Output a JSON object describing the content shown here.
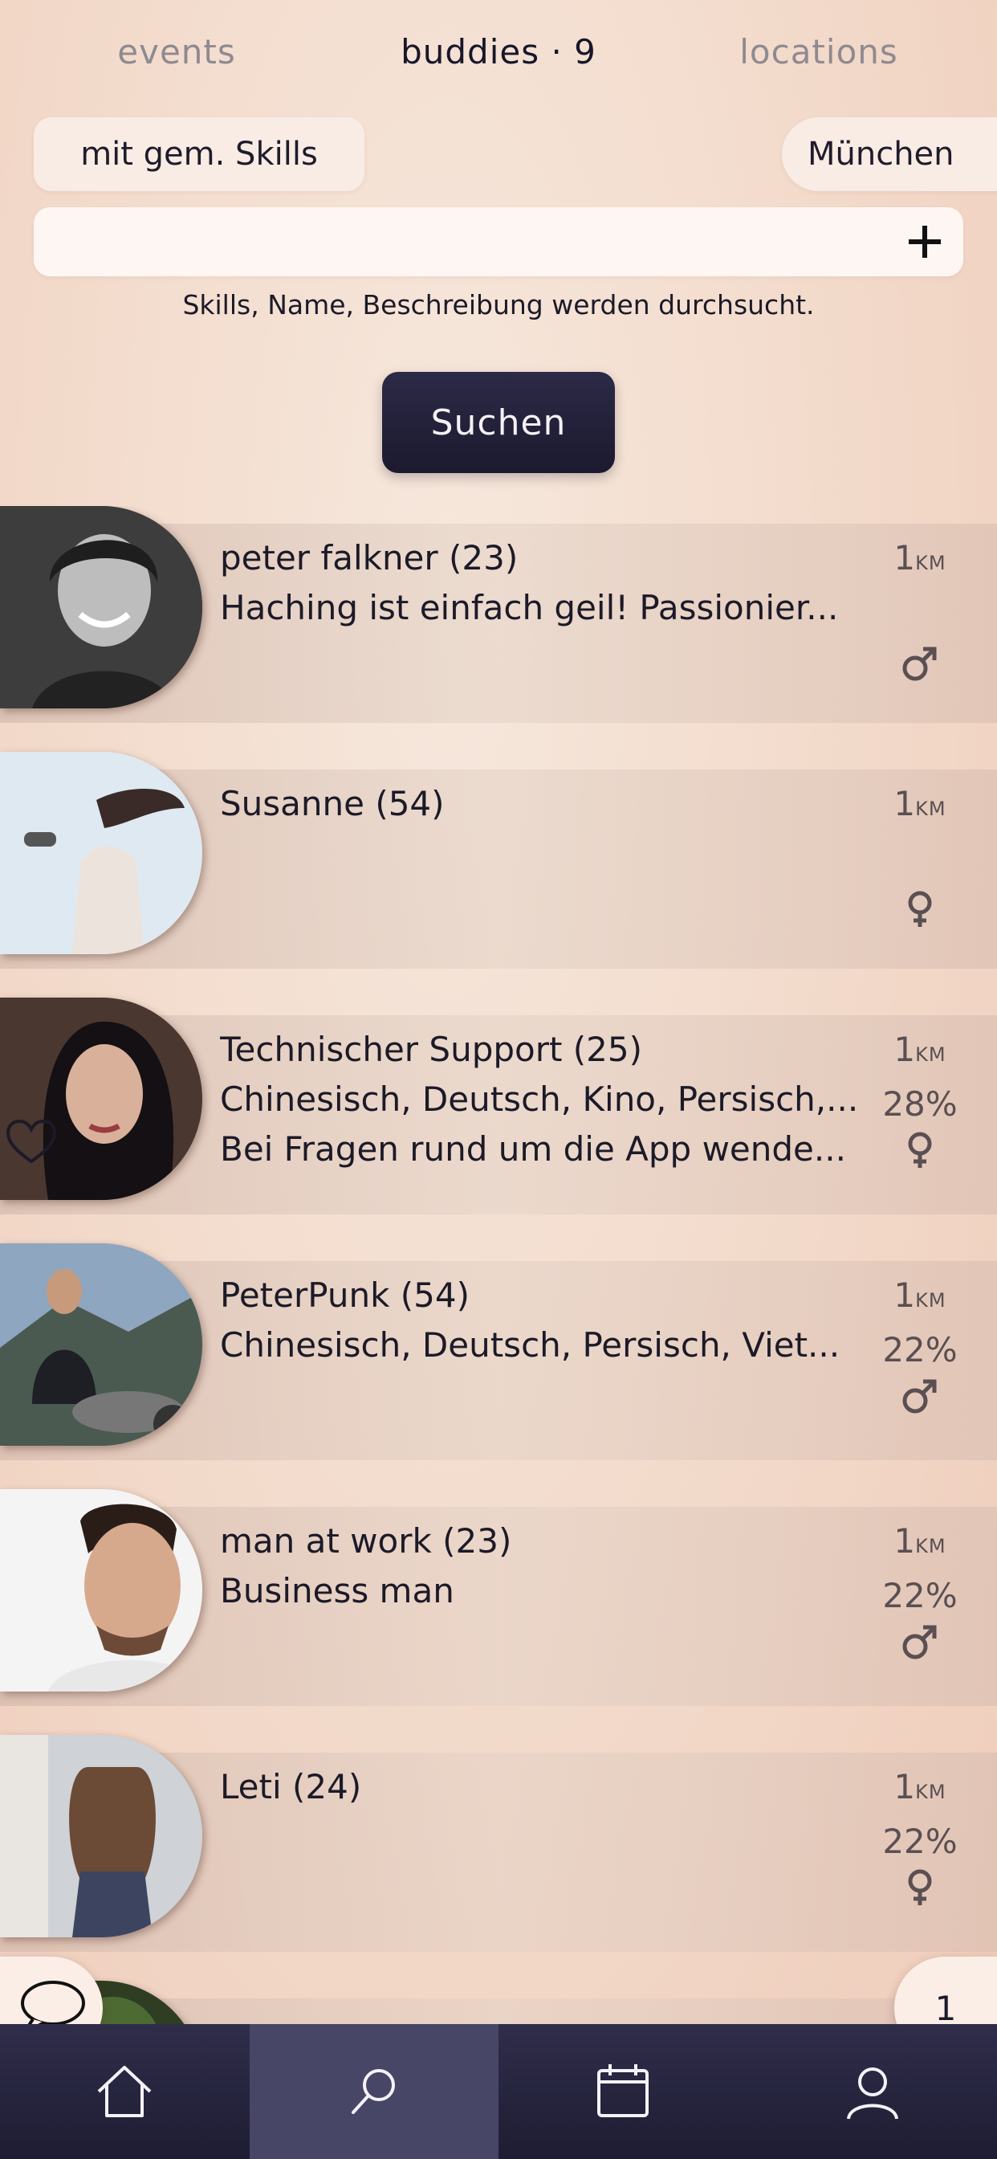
{
  "tabs": [
    {
      "label": "events",
      "active": false
    },
    {
      "label": "buddies · 9",
      "active": true
    },
    {
      "label": "locations",
      "active": false
    }
  ],
  "filters": {
    "skills_chip": "mit gem. Skills",
    "city_chip": "München"
  },
  "search": {
    "value": "",
    "placeholder": "",
    "hint": "Skills, Name, Beschreibung werden durchsucht.",
    "button_label": "Suchen"
  },
  "buddies": [
    {
      "name": "peter falkner (23)",
      "line2": "Haching ist einfach geil! Passionier...",
      "line3": "",
      "distance": "1",
      "unit": "KM",
      "match": "",
      "gender": "male",
      "favorite": false
    },
    {
      "name": "Susanne (54)",
      "line2": "",
      "line3": "",
      "distance": "1",
      "unit": "KM",
      "match": "",
      "gender": "female",
      "favorite": false
    },
    {
      "name": "Technischer Support (25)",
      "line2": "Chinesisch, Deutsch, Kino, Persisch,...",
      "line3": "Bei Fragen rund um die App wende...",
      "distance": "1",
      "unit": "KM",
      "match": "28%",
      "gender": "female",
      "favorite": true
    },
    {
      "name": "PeterPunk (54)",
      "line2": "Chinesisch, Deutsch, Persisch, Viet...",
      "line3": "",
      "distance": "1",
      "unit": "KM",
      "match": "22%",
      "gender": "male",
      "favorite": false
    },
    {
      "name": "man at work (23)",
      "line2": "Business man",
      "line3": "",
      "distance": "1",
      "unit": "KM",
      "match": "22%",
      "gender": "male",
      "favorite": false
    },
    {
      "name": "Leti (24)",
      "line2": "",
      "line3": "",
      "distance": "1",
      "unit": "KM",
      "match": "22%",
      "gender": "female",
      "favorite": false
    }
  ],
  "page_badge": "1",
  "nav": [
    {
      "icon": "home-icon",
      "active": false
    },
    {
      "icon": "search-icon",
      "active": true
    },
    {
      "icon": "calendar-icon",
      "active": false
    },
    {
      "icon": "profile-icon",
      "active": false
    }
  ],
  "colors": {
    "accent_dark": "#1f1d33",
    "nav_active": "#474666",
    "background": "#f3dccd"
  }
}
